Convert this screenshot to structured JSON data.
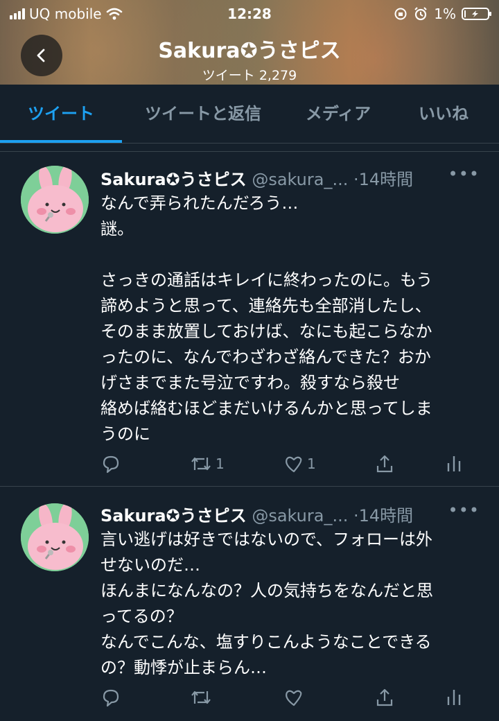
{
  "status_bar": {
    "carrier": "UQ mobile",
    "time": "12:28",
    "battery_label": "1%",
    "battery_level": 0.01
  },
  "header": {
    "title": "Sakura✪うさピス",
    "tweet_count_label": "ツイート 2,279"
  },
  "tabs": [
    {
      "label": "ツイート",
      "active": true
    },
    {
      "label": "ツイートと返信",
      "active": false
    },
    {
      "label": "メディア",
      "active": false
    },
    {
      "label": "いいね",
      "active": false
    }
  ],
  "tweets": [
    {
      "display_name": "Sakura✪うさピス",
      "handle": "@sakura_...",
      "time": "·14時間",
      "text": "なんで弄られたんだろう…\n謎。\n\nさっきの通話はキレイに終わったのに。もう\n諦めようと思って、連絡先も全部消したし、\nそのまま放置しておけば、なにも起こらなか\nったのに、なんでわざわざ絡んできた？おか\nげさまでまた号泣ですわ。殺すなら殺せ\n絡めば絡むほどまだいけるんかと思ってしま\nうのに",
      "reply_count": "",
      "retweet_count": "1",
      "like_count": "1"
    },
    {
      "display_name": "Sakura✪うさピス",
      "handle": "@sakura_...",
      "time": "·14時間",
      "text": "言い逃げは好きではないので、フォローは外\nせないのだ…\nほんまになんなの？人の気持ちをなんだと思\nってるの？\nなんでこんな、塩すりこんようなことできる\nの？動悸が止まらん…",
      "reply_count": "",
      "retweet_count": "",
      "like_count": ""
    }
  ],
  "icons": [
    "signal-icon",
    "wifi-icon",
    "orientation-lock-icon",
    "alarm-icon",
    "battery-icon",
    "back-arrow-icon",
    "more-icon",
    "reply-icon",
    "retweet-icon",
    "like-icon",
    "share-icon",
    "analytics-icon"
  ],
  "colors": {
    "background": "#15202b",
    "accent": "#1da1f2",
    "muted": "#8899a6",
    "divider": "#38444d"
  }
}
